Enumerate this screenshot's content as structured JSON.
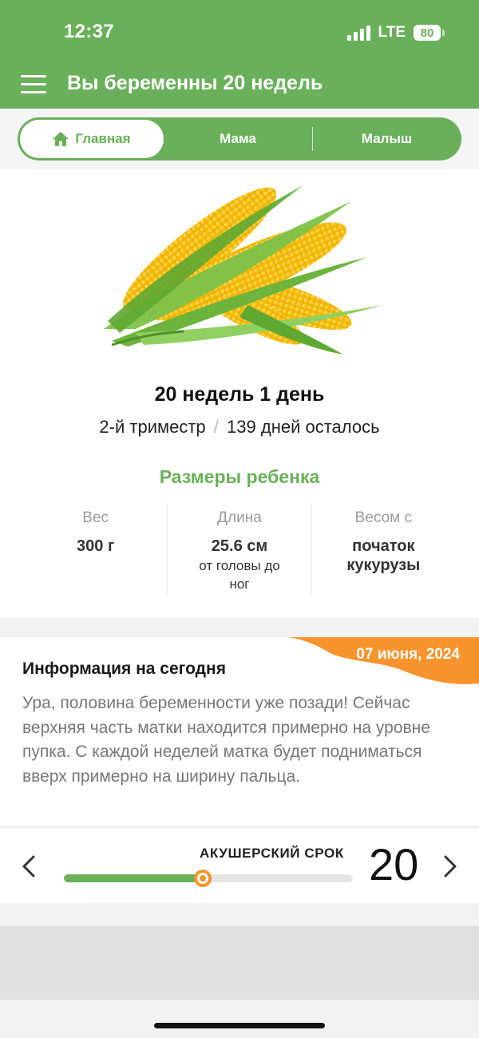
{
  "status_bar": {
    "time": "12:37",
    "network": "LTE",
    "battery": "80"
  },
  "header": {
    "title": "Вы беременны 20 недель",
    "menu_icon": "hamburger-menu-icon"
  },
  "tabs": [
    {
      "label": "Главная",
      "icon": "home-icon",
      "active": true
    },
    {
      "label": "Мама",
      "active": false
    },
    {
      "label": "Малыш",
      "active": false
    }
  ],
  "summary": {
    "week_title": "20 недель 1 день",
    "trimester": "2-й триместр",
    "separator": "/",
    "days_left": "139 дней осталось"
  },
  "baby_size": {
    "heading": "Размеры ребенка",
    "stats": [
      {
        "label": "Вес",
        "value": "300 г",
        "note": ""
      },
      {
        "label": "Длина",
        "value": "25.6 см",
        "note": "от головы до ног"
      },
      {
        "label": "Весом с",
        "value": "початок кукурузы",
        "note": ""
      }
    ]
  },
  "info": {
    "date": "07 июня, 2024",
    "title": "Информация на сегодня",
    "body": "Ура, половина беременности уже позади! Сейчас верхняя часть матки находится примерно на уровне пупка. С каждой неделей матка будет подниматься вверх примерно на ширину пальца."
  },
  "week_slider": {
    "label": "АКУШЕРСКИЙ СРОК",
    "value": "20",
    "progress": 0.48
  },
  "colors": {
    "primary": "#6ab05a",
    "accent": "#f7942d",
    "muted_text": "#777777"
  }
}
